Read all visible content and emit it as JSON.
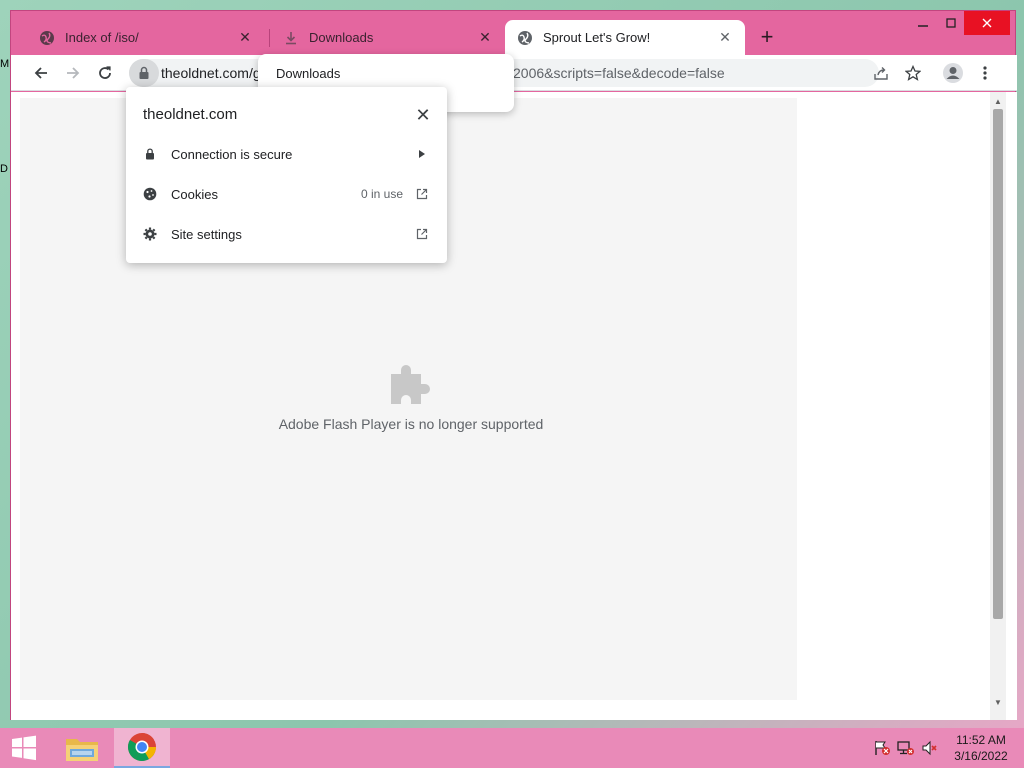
{
  "tabs": [
    {
      "title": "Index of /iso/",
      "icon": "globe-icon"
    },
    {
      "title": "Downloads",
      "icon": "download-icon"
    },
    {
      "title": "Sprout Let's Grow!",
      "icon": "globe-icon"
    }
  ],
  "toolbar": {
    "url_host_visible": "theoldnet.com/g",
    "url_tail_visible": "2006&scripts=false&decode=false"
  },
  "downloads_popup": {
    "title": "Downloads"
  },
  "site_info": {
    "host": "theoldnet.com",
    "rows": [
      {
        "label": "Connection is secure",
        "aux": "",
        "icon": "lock-icon",
        "trail": "chevron-right-icon"
      },
      {
        "label": "Cookies",
        "aux": "0 in use",
        "icon": "cookie-icon",
        "trail": "external-link-icon"
      },
      {
        "label": "Site settings",
        "aux": "",
        "icon": "gear-icon",
        "trail": "external-link-icon"
      }
    ]
  },
  "page": {
    "plugin_message": "Adobe Flash Player is no longer supported"
  },
  "desktop_edge": {
    "frag1": "M",
    "frag2": "D"
  },
  "taskbar": {
    "time": "11:52 AM",
    "date": "3/16/2022"
  },
  "colors": {
    "window_frame": "#e4669f",
    "taskbar": "#e98ab8",
    "close_button": "#e81123"
  }
}
